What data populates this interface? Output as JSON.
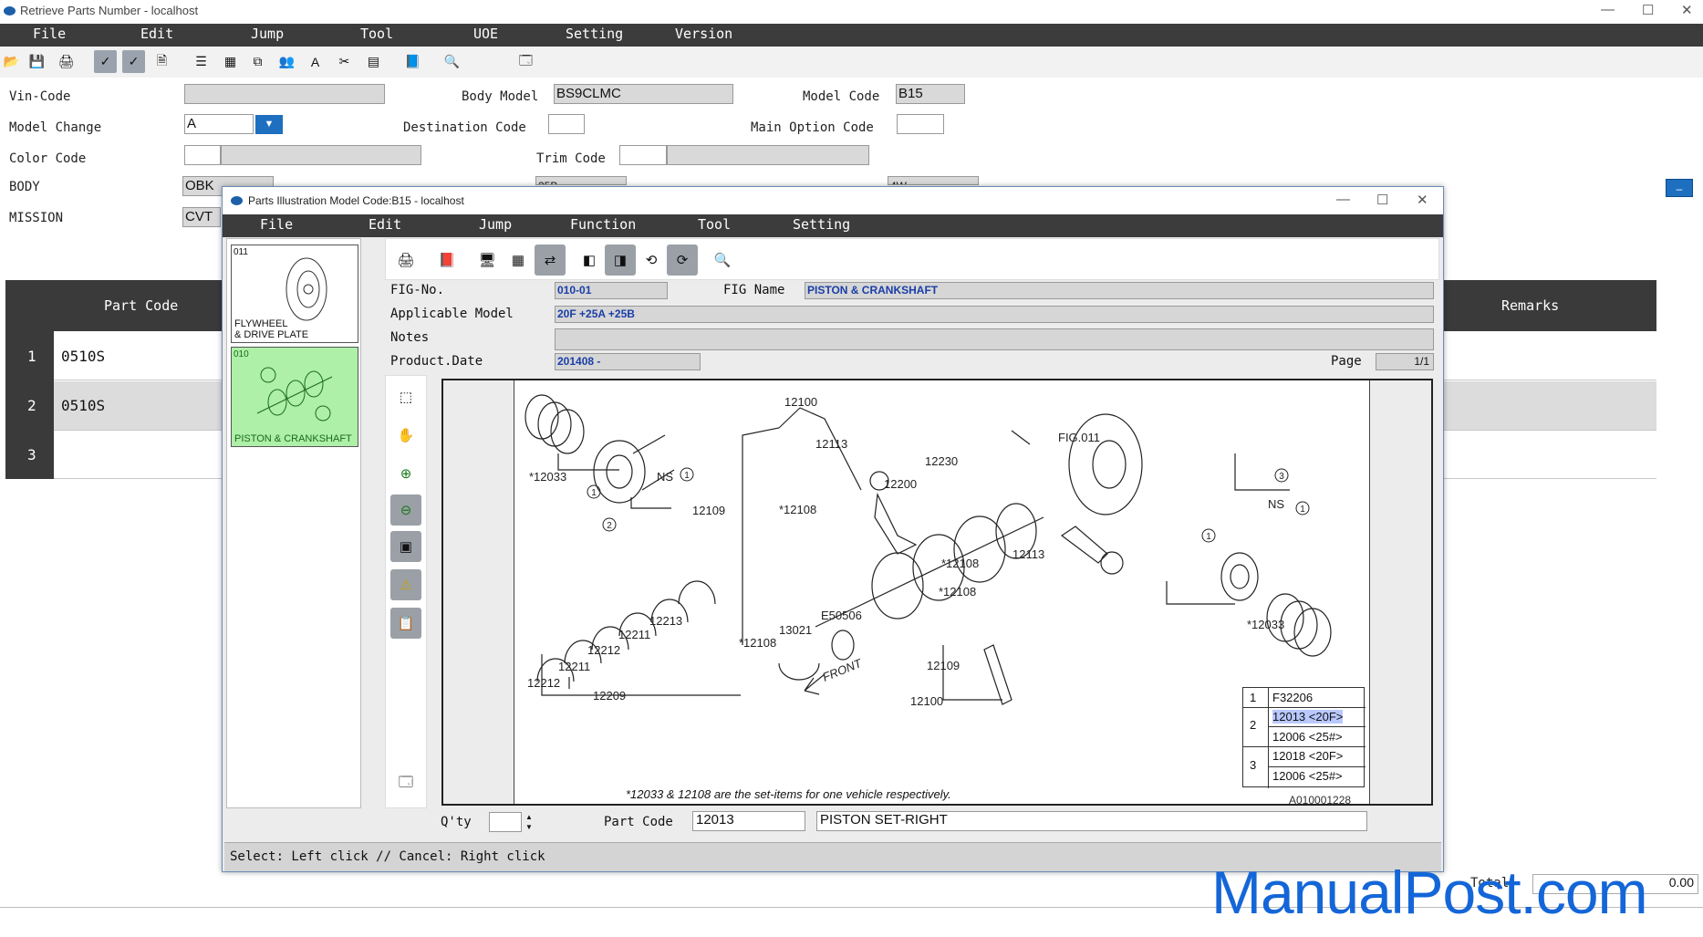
{
  "main_window": {
    "title": "Retrieve Parts Number - localhost",
    "menu": [
      "File",
      "Edit",
      "Jump",
      "Tool",
      "UOE",
      "Setting",
      "Version"
    ]
  },
  "vehicle_form": {
    "vin_code_label": "Vin-Code",
    "vin_code_value": "",
    "body_model_label": "Body Model",
    "body_model_value": "BS9CLMC",
    "model_code_label": "Model Code",
    "model_code_value": "B15",
    "model_change_label": "Model Change",
    "model_change_value": "A",
    "destination_code_label": "Destination Code",
    "destination_code_value": "",
    "main_option_code_label": "Main Option Code",
    "main_option_code_value": "",
    "color_code_label": "Color Code",
    "color_code_value": "",
    "trim_code_label": "Trim Code",
    "trim_code_value": "",
    "body_label": "BODY",
    "body_value": "OBK",
    "mission_label": "MISSION",
    "mission_value": "CVT",
    "engine_value": "25B",
    "drive_value": "4W"
  },
  "parts_table": {
    "headers": {
      "part_code": "Part Code",
      "remarks": "Remarks"
    },
    "rows": [
      {
        "no": "1",
        "part_code": "0510S"
      },
      {
        "no": "2",
        "part_code": "0510S"
      },
      {
        "no": "3",
        "part_code": ""
      }
    ],
    "total_label": "Total",
    "total_value": "0.00"
  },
  "illustration_window": {
    "title": "Parts Illustration Model Code:B15 - localhost",
    "menu": [
      "File",
      "Edit",
      "Jump",
      "Function",
      "Tool",
      "Setting"
    ],
    "thumbnails": [
      {
        "code": "011",
        "caption_line1": "FLYWHEEL",
        "caption_line2": "& DRIVE PLATE"
      },
      {
        "code": "010",
        "caption_line1": "PISTON & CRANKSHAFT",
        "caption_line2": ""
      }
    ],
    "fig_no_label": "FIG-No.",
    "fig_no_value": "010-01",
    "fig_name_label": "FIG Name",
    "fig_name_value": "PISTON & CRANKSHAFT",
    "applicable_model_label": "Applicable Model",
    "applicable_model_value": "20F +25A +25B",
    "notes_label": "Notes",
    "notes_value": "",
    "product_date_label": "Product.Date",
    "product_date_value": "201408 -",
    "page_label": "Page",
    "page_value": "1/1",
    "qty_label": "Q'ty",
    "qty_value": "",
    "part_code_label": "Part Code",
    "part_code_value": "12013",
    "part_name_value": "PISTON SET-RIGHT",
    "status_text": "Select: Left click // Cancel: Right click"
  },
  "diagram": {
    "labels": {
      "l12100": "12100",
      "l12113a": "12113",
      "l12230": "12230",
      "lfig011": "FIG.011",
      "l12033a": "*12033",
      "lns1": "NS",
      "l12109a": "12109",
      "l12108a": "*12108",
      "l12200": "12200",
      "l12108b": "*12108",
      "l12113b": "12113",
      "l12108c": "*12108",
      "le50506": "E50506",
      "l13021": "13021",
      "l12108d": "*12108",
      "l12213": "12213",
      "l12211a": "12211",
      "l12212a": "12212",
      "l12211b": "12211",
      "l12212b": "12212",
      "l12209": "12209",
      "l12109b": "12109",
      "l12100b": "12100",
      "lns2": "NS",
      "l12033b": "*12033",
      "lfront": "FRONT",
      "c1": "1",
      "c2": "2",
      "c3": "3"
    },
    "legend": [
      {
        "group": "1",
        "parts": [
          "F32206"
        ]
      },
      {
        "group": "2",
        "parts": [
          "12013 <20F>",
          "12006 <25#>"
        ]
      },
      {
        "group": "3",
        "parts": [
          "12018 <20F>",
          "12006 <25#>"
        ]
      }
    ],
    "footnote": "*12033 & 12108 are the set-items for one vehicle respectively.",
    "drawing_id": "A010001228"
  },
  "watermark": "ManualPost.com"
}
